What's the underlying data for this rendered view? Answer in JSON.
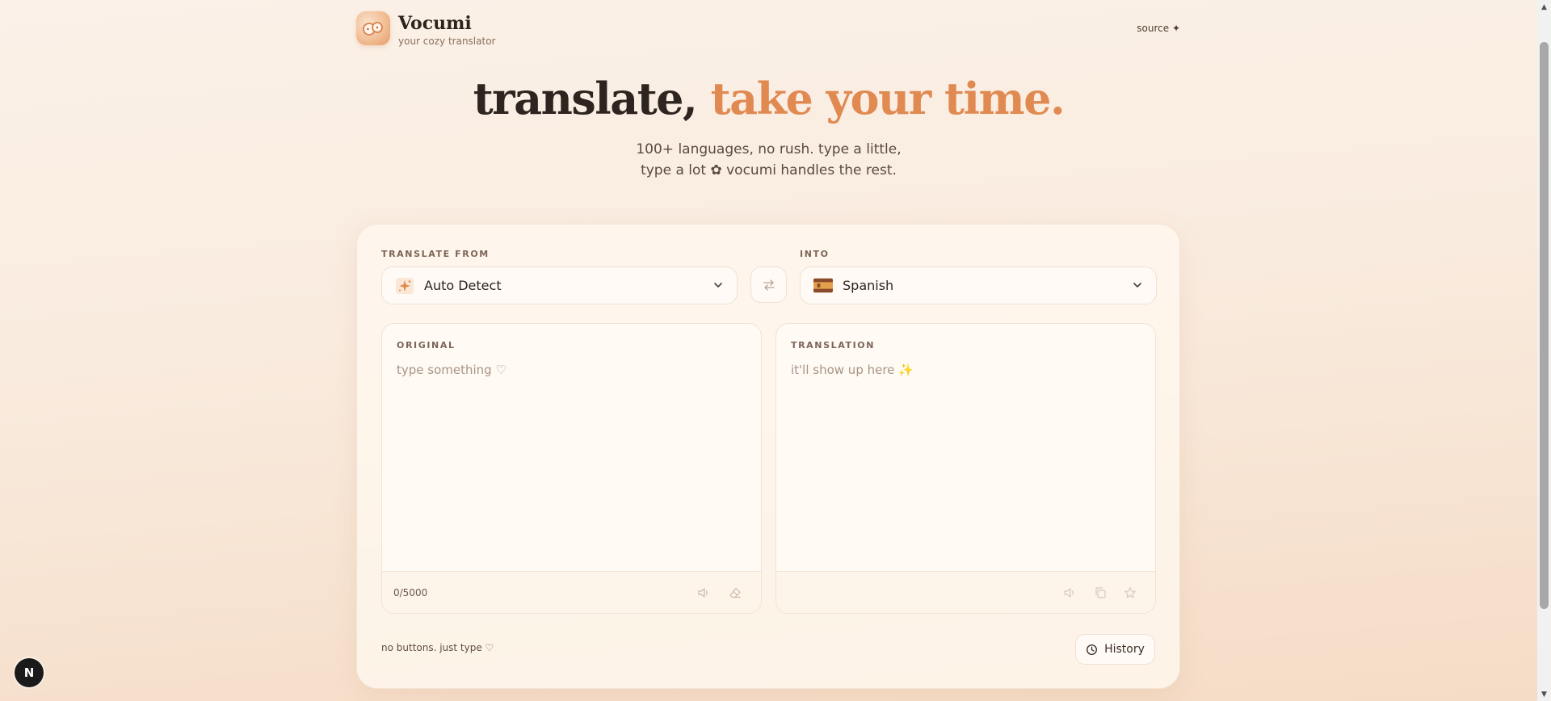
{
  "brand": {
    "name": "Vocumi",
    "tagline": "your cozy translator",
    "source_link": "source ✦"
  },
  "hero": {
    "title_main": "translate, ",
    "title_accent": "take your time.",
    "subtitle_line1": "100+ languages, no rush. type a little,",
    "subtitle_line2": "type a lot ✿ vocumi handles the rest."
  },
  "translator": {
    "from_label": "TRANSLATE FROM",
    "from_value": "Auto Detect",
    "from_icon": "sparkle-icon",
    "into_label": "INTO",
    "into_value": "Spanish",
    "into_icon": "spain-flag-icon",
    "swap_icon": "swap-arrows-icon",
    "original": {
      "label": "ORIGINAL",
      "placeholder": "type something ♡",
      "counter": "0/5000"
    },
    "translation": {
      "label": "TRANSLATION",
      "placeholder": "it'll show up here ✨"
    },
    "hint": "no buttons. just type ♡",
    "history_label": "History"
  },
  "colors": {
    "accent": "#e08a52",
    "text_dark": "#2e2520",
    "muted": "#a99585"
  },
  "dev_badge": "N"
}
